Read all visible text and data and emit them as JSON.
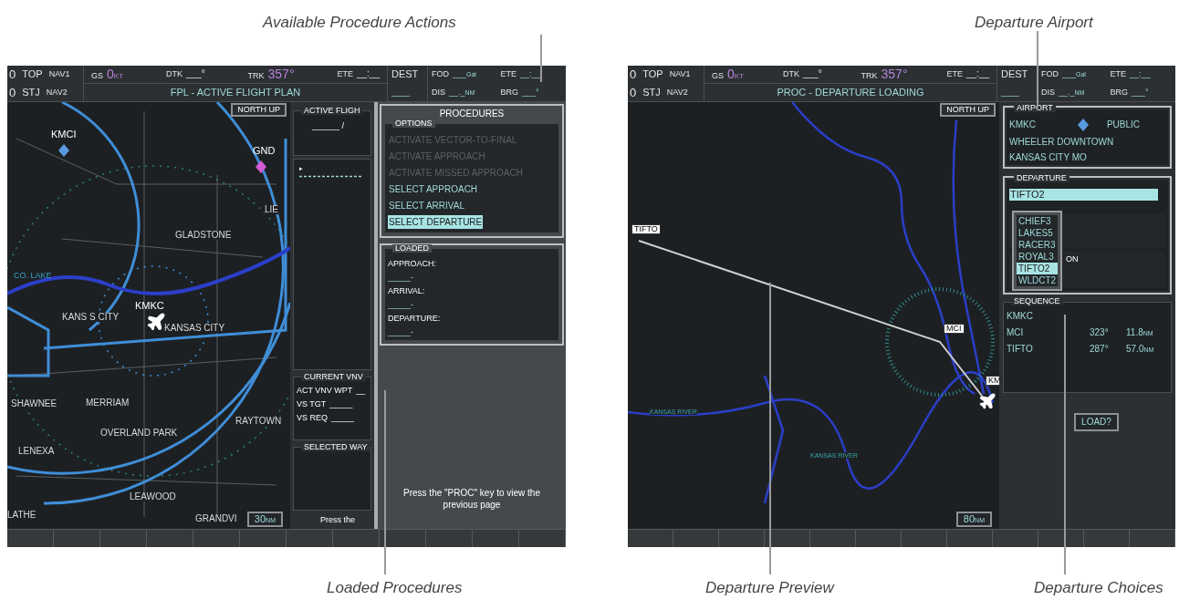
{
  "callouts_top": [
    "Available Procedure Actions",
    "Departure Airport"
  ],
  "left_screen": {
    "header": {
      "nav_rows": [
        [
          "0",
          "TOP",
          "NAV1"
        ],
        [
          "0",
          "STJ",
          "NAV2"
        ]
      ],
      "fields": [
        {
          "label": "GS",
          "value": "0",
          "unit": "KT",
          "kind": "live"
        },
        {
          "label": "DTK",
          "value": "___°",
          "kind": "empty"
        },
        {
          "label": "TRK",
          "value": "357°",
          "kind": "live"
        },
        {
          "label": "ETE",
          "value": "__:__",
          "kind": "empty"
        }
      ],
      "title": "FPL - ACTIVE FLIGHT PLAN",
      "dest": {
        "label": "DEST",
        "value": "____",
        "fields": [
          {
            "label": "FOD",
            "value": "___",
            "unit": "Gal"
          },
          {
            "label": "ETE",
            "value": "__:__"
          },
          {
            "label": "DIS",
            "value": "__._",
            "unit": "NM"
          },
          {
            "label": "BRG",
            "value": "___°"
          }
        ]
      }
    },
    "map": {
      "orientation": "NORTH UP",
      "scale_value": "30",
      "scale_unit": "NM",
      "labels": [
        {
          "text": "KMCI",
          "kind": "airport"
        },
        {
          "text": "GND",
          "kind": "airport"
        },
        {
          "text": "LIE",
          "kind": "city"
        },
        {
          "text": "GLADSTONE",
          "kind": "city"
        },
        {
          "text": "CO. LAKE",
          "kind": "water"
        },
        {
          "text": "KMKC",
          "kind": "airport"
        },
        {
          "text": "KANS S CITY",
          "kind": "city"
        },
        {
          "text": "KANSAS CITY",
          "kind": "city"
        },
        {
          "text": "SHAWNEE",
          "kind": "city"
        },
        {
          "text": "MERRIAM",
          "kind": "city"
        },
        {
          "text": "RAYTOWN",
          "kind": "city"
        },
        {
          "text": "OVERLAND PARK",
          "kind": "city"
        },
        {
          "text": "LENEXA",
          "kind": "city"
        },
        {
          "text": "LEAWOOD",
          "kind": "city"
        },
        {
          "text": "LATHE",
          "kind": "city"
        },
        {
          "text": "GRANDVI",
          "kind": "city"
        }
      ]
    },
    "flight_plan": {
      "title": "ACTIVE FLIGH",
      "plan_name": "______ /",
      "marker": "▸",
      "vnav": {
        "title": "CURRENT VNV",
        "rows": [
          {
            "label": "ACT VNV WPT",
            "value": "__"
          },
          {
            "label": "VS TGT",
            "value": "_____"
          },
          {
            "label": "VS REQ",
            "value": "_____"
          }
        ]
      },
      "selected_waypoint": {
        "title": "SELECTED WAY"
      },
      "footer": "Press the"
    },
    "procedures": {
      "title": "PROCEDURES",
      "options_title": "OPTIONS",
      "options": [
        {
          "label": "ACTIVATE VECTOR-TO-FINAL",
          "disabled": true,
          "selected": false
        },
        {
          "label": "ACTIVATE APPROACH",
          "disabled": true,
          "selected": false
        },
        {
          "label": "ACTIVATE MISSED APPROACH",
          "disabled": true,
          "selected": false
        },
        {
          "label": "SELECT APPROACH",
          "disabled": false,
          "selected": false
        },
        {
          "label": "SELECT ARRIVAL",
          "disabled": false,
          "selected": false
        },
        {
          "label": "SELECT DEPARTURE",
          "disabled": false,
          "selected": true
        }
      ],
      "loaded_title": "LOADED",
      "loaded": [
        {
          "label": "APPROACH:",
          "value": "_____-"
        },
        {
          "label": "ARRIVAL:",
          "value": "_____-"
        },
        {
          "label": "DEPARTURE:",
          "value": "_____-"
        }
      ],
      "footer": "Press the \"PROC\" key to view the previous page"
    }
  },
  "right_screen": {
    "header": {
      "nav_rows": [
        [
          "0",
          "TOP",
          "NAV1"
        ],
        [
          "0",
          "STJ",
          "NAV2"
        ]
      ],
      "fields": [
        {
          "label": "GS",
          "value": "0",
          "unit": "KT",
          "kind": "live"
        },
        {
          "label": "DTK",
          "value": "___°",
          "kind": "empty"
        },
        {
          "label": "TRK",
          "value": "357°",
          "kind": "live"
        },
        {
          "label": "ETE",
          "value": "__:__",
          "kind": "empty"
        }
      ],
      "title": "PROC - DEPARTURE LOADING",
      "dest": {
        "label": "DEST",
        "value": "____",
        "fields": [
          {
            "label": "FOD",
            "value": "___",
            "unit": "Gal"
          },
          {
            "label": "ETE",
            "value": "__:__"
          },
          {
            "label": "DIS",
            "value": "__._",
            "unit": "NM"
          },
          {
            "label": "BRG",
            "value": "___°"
          }
        ]
      }
    },
    "map": {
      "orientation": "NORTH UP",
      "scale_value": "80",
      "scale_unit": "NM",
      "labels": [
        {
          "text": "TIFTO",
          "kind": "waypoint"
        },
        {
          "text": "MCI",
          "kind": "waypoint"
        },
        {
          "text": "KM",
          "kind": "waypoint"
        },
        {
          "text": "KANSAS RIVER",
          "kind": "river"
        },
        {
          "text": "KANSAS RIVER",
          "kind": "river"
        }
      ]
    },
    "airport": {
      "title": "AIRPORT",
      "id": "KMKC",
      "use": "PUBLIC",
      "name": "WHEELER DOWNTOWN",
      "city": "KANSAS CITY MO"
    },
    "departure": {
      "title": "DEPARTURE",
      "value": "TIFTO2",
      "partial_label": "ON",
      "choices": [
        {
          "label": "CHIEF3",
          "selected": false
        },
        {
          "label": "LAKES5",
          "selected": false
        },
        {
          "label": "RACER3",
          "selected": false
        },
        {
          "label": "ROYAL3",
          "selected": false
        },
        {
          "label": "TIFTO2",
          "selected": true
        },
        {
          "label": "WLDCT2",
          "selected": false
        }
      ]
    },
    "sequence": {
      "title": "SEQUENCE",
      "rows": [
        {
          "waypoint": "KMKC"
        },
        {
          "waypoint": "MCI",
          "course": "323°",
          "distance": "11.8",
          "unit": "NM"
        },
        {
          "waypoint": "TIFTO",
          "course": "287°",
          "distance": "57.0",
          "unit": "NM"
        }
      ]
    },
    "load_button": "LOAD?"
  },
  "callouts_bottom": [
    "Loaded Procedures",
    "Departure Preview",
    "Departure Choices"
  ]
}
